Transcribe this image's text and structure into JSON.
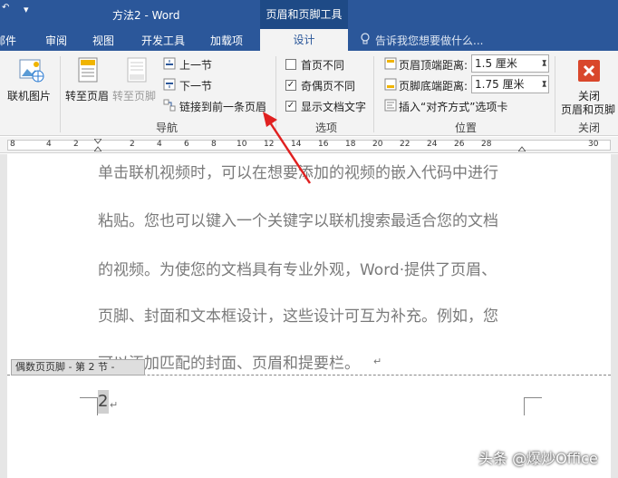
{
  "titlebar": {
    "doc_title": "方法2 - Word",
    "context_group": "页眉和页脚工具"
  },
  "tabs": {
    "mail": "邮件",
    "review": "审阅",
    "view": "视图",
    "developer": "开发工具",
    "addins": "加载项",
    "design": "设计",
    "tell_me": "告诉我您想要做什么..."
  },
  "ribbon": {
    "online_picture": "联机图片",
    "goto_header": "转至页眉",
    "goto_footer": "转至页脚",
    "previous": "上一节",
    "next": "下一节",
    "link_previous": "链接到前一条页眉",
    "nav_group": "导航",
    "different_first": "首页不同",
    "different_odd_even": "奇偶页不同",
    "show_doc_text": "显示文档文字",
    "options_group": "选项",
    "header_top_label": "页眉顶端距离:",
    "header_top_value": "1.5 厘米",
    "footer_bottom_label": "页脚底端距离:",
    "footer_bottom_value": "1.75 厘米",
    "insert_align_tab": "插入“对齐方式”选项卡",
    "position_group": "位置",
    "close_label_1": "关闭",
    "close_label_2": "页眉和页脚",
    "close_group": "关闭",
    "checks": {
      "different_first": false,
      "different_odd_even": true,
      "show_doc_text": true
    }
  },
  "ruler": {
    "labels": [
      "8",
      "4",
      "2",
      "2",
      "4",
      "6",
      "8",
      "10",
      "12",
      "14",
      "16",
      "18",
      "20",
      "22",
      "24",
      "26",
      "28",
      "30"
    ]
  },
  "document": {
    "lines": [
      "单击联机视频时，可以在想要添加的视频的嵌入代码中进行",
      "粘贴。您也可以键入一个关键字以联机搜索最适合您的文档",
      "的视频。为使您的文档具有专业外观，Word·提供了页眉、",
      "页脚、封面和文本框设计，这些设计可互为补充。例如，您",
      "可以添加匹配的封面、页眉和提要栏。"
    ],
    "footer_tag": "偶数页页脚 - 第 2 节 -",
    "page_number": "2",
    "para_mark": "↵"
  },
  "watermark": "头条 @爆炒Office",
  "colors": {
    "word_blue": "#2b579a",
    "close_red": "#d9472b",
    "arrow_red": "#e02020"
  }
}
